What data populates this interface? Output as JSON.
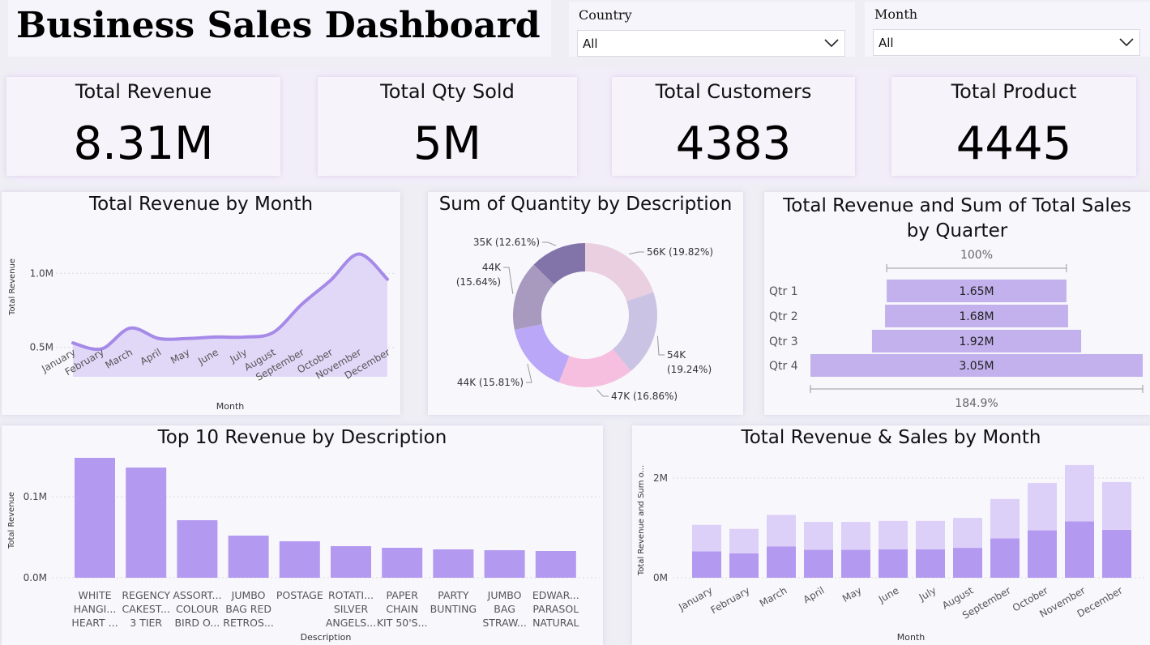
{
  "header": {
    "title": "Business Sales Dashboard"
  },
  "filters": {
    "country": {
      "label": "Country",
      "value": "All"
    },
    "month": {
      "label": "Month",
      "value": "All"
    }
  },
  "kpis": [
    {
      "label": "Total Revenue",
      "value": "8.31M"
    },
    {
      "label": "Total Qty Sold",
      "value": "5M"
    },
    {
      "label": "Total Customers",
      "value": "4383"
    },
    {
      "label": "Total Product",
      "value": "4445"
    }
  ],
  "colors": {
    "accent": "#b39af0",
    "area_fill": "#ddd2f7",
    "line": "#a58ae8",
    "light": "#ddd0f8",
    "panel": "#f8f7fc"
  },
  "chart_data": [
    {
      "id": "revenue-by-month",
      "type": "area",
      "title": "Total Revenue by Month",
      "xlabel": "Month",
      "ylabel": "Total Revenue",
      "categories": [
        "January",
        "February",
        "March",
        "April",
        "May",
        "June",
        "July",
        "August",
        "September",
        "October",
        "November",
        "December"
      ],
      "values": [
        0.53,
        0.49,
        0.63,
        0.56,
        0.56,
        0.57,
        0.57,
        0.6,
        0.79,
        0.95,
        1.13,
        0.96
      ],
      "ytick_labels": [
        "0.5M",
        "1.0M"
      ],
      "ylim": [
        0.28,
        1.22
      ]
    },
    {
      "id": "quantity-by-description",
      "type": "pie",
      "title": "Sum of Quantity by Description",
      "slices": [
        {
          "label": "56K (19.82%)",
          "value": 19.82,
          "color": "#e9cfe0"
        },
        {
          "label": "54K (19.24%)",
          "value": 19.24,
          "color": "#cbc3e3"
        },
        {
          "label": "47K (16.86%)",
          "value": 16.86,
          "color": "#f6bfdf"
        },
        {
          "label": "44K (15.81%)",
          "value": 15.81,
          "color": "#bba7f7"
        },
        {
          "label": "44K (15.64%)",
          "value": 15.64,
          "color": "#a89abf"
        },
        {
          "label": "35K (12.61%)",
          "value": 12.61,
          "color": "#8273a8"
        }
      ]
    },
    {
      "id": "revenue-by-quarter",
      "type": "bar",
      "title": "Total Revenue and Sum of Total Sales by Quarter",
      "categories": [
        "Qtr 1",
        "Qtr 2",
        "Qtr 3",
        "Qtr 4"
      ],
      "values": [
        1.65,
        1.68,
        1.92,
        3.05
      ],
      "value_labels": [
        "1.65M",
        "1.68M",
        "1.92M",
        "3.05M"
      ],
      "top_label": "100%",
      "bottom_label": "184.9%"
    },
    {
      "id": "top10-revenue",
      "type": "bar",
      "title": "Top 10 Revenue by Description",
      "xlabel": "Description",
      "ylabel": "Total Revenue",
      "categories": [
        [
          "WHITE",
          "HANGI...",
          "HEART ..."
        ],
        [
          "REGENCY",
          "CAKEST...",
          "3 TIER"
        ],
        [
          "ASSORT...",
          "COLOUR",
          "BIRD O..."
        ],
        [
          "JUMBO",
          "BAG RED",
          "RETROS..."
        ],
        [
          "POSTAGE"
        ],
        [
          "ROTATI...",
          "SILVER",
          "ANGELS..."
        ],
        [
          "PAPER",
          "CHAIN",
          "KIT 50'S..."
        ],
        [
          "PARTY",
          "BUNTING"
        ],
        [
          "JUMBO",
          "BAG",
          "STRAW..."
        ],
        [
          "EDWAR...",
          "PARASOL",
          "NATURAL"
        ]
      ],
      "values": [
        0.148,
        0.136,
        0.071,
        0.052,
        0.045,
        0.039,
        0.037,
        0.035,
        0.034,
        0.033
      ],
      "ytick_labels": [
        "0.0M",
        "0.1M"
      ],
      "ylim": [
        0,
        0.16
      ]
    },
    {
      "id": "revenue-sales-by-month",
      "type": "bar",
      "title": "Total Revenue & Sales by Month",
      "xlabel": "Month",
      "ylabel": "Total Revenue and Sum o...",
      "categories": [
        "January",
        "February",
        "March",
        "April",
        "May",
        "June",
        "July",
        "August",
        "September",
        "October",
        "November",
        "December"
      ],
      "series": [
        {
          "values": [
            0.53,
            0.49,
            0.63,
            0.56,
            0.56,
            0.57,
            0.57,
            0.6,
            0.79,
            0.95,
            1.13,
            0.96
          ]
        },
        {
          "values": [
            0.53,
            0.49,
            0.63,
            0.56,
            0.56,
            0.57,
            0.57,
            0.6,
            0.79,
            0.95,
            1.13,
            0.96
          ]
        }
      ],
      "ytick_labels": [
        "0M",
        "2M"
      ],
      "ylim": [
        0,
        2.6
      ]
    }
  ]
}
